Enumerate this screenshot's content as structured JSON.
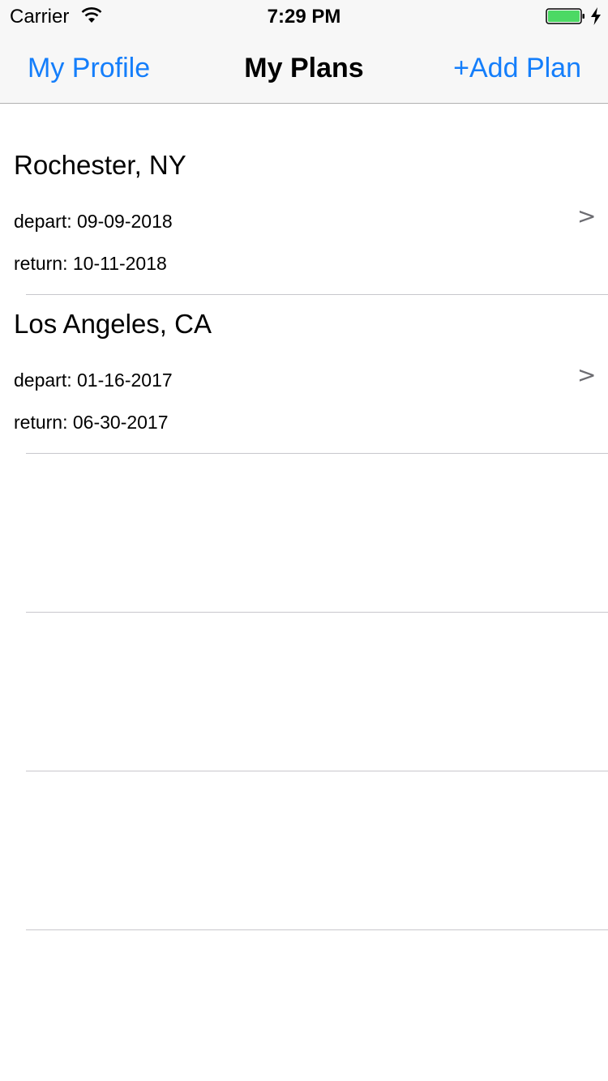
{
  "status_bar": {
    "carrier": "Carrier",
    "time": "7:29 PM",
    "battery_color": "#4cd964"
  },
  "nav": {
    "left_label": "My Profile",
    "title": "My Plans",
    "right_label": "+Add Plan",
    "accent_color": "#147efb"
  },
  "plans": [
    {
      "city": "Rochester, NY",
      "depart": "depart: 09-09-2018",
      "return": "return: 10-11-2018",
      "chevron": ">"
    },
    {
      "city": "Los Angeles, CA",
      "depart": "depart: 01-16-2017",
      "return": "return: 06-30-2017",
      "chevron": ">"
    }
  ],
  "icons": [
    "wifi-icon",
    "battery-icon",
    "charging-bolt-icon",
    "chevron-right-icon"
  ]
}
